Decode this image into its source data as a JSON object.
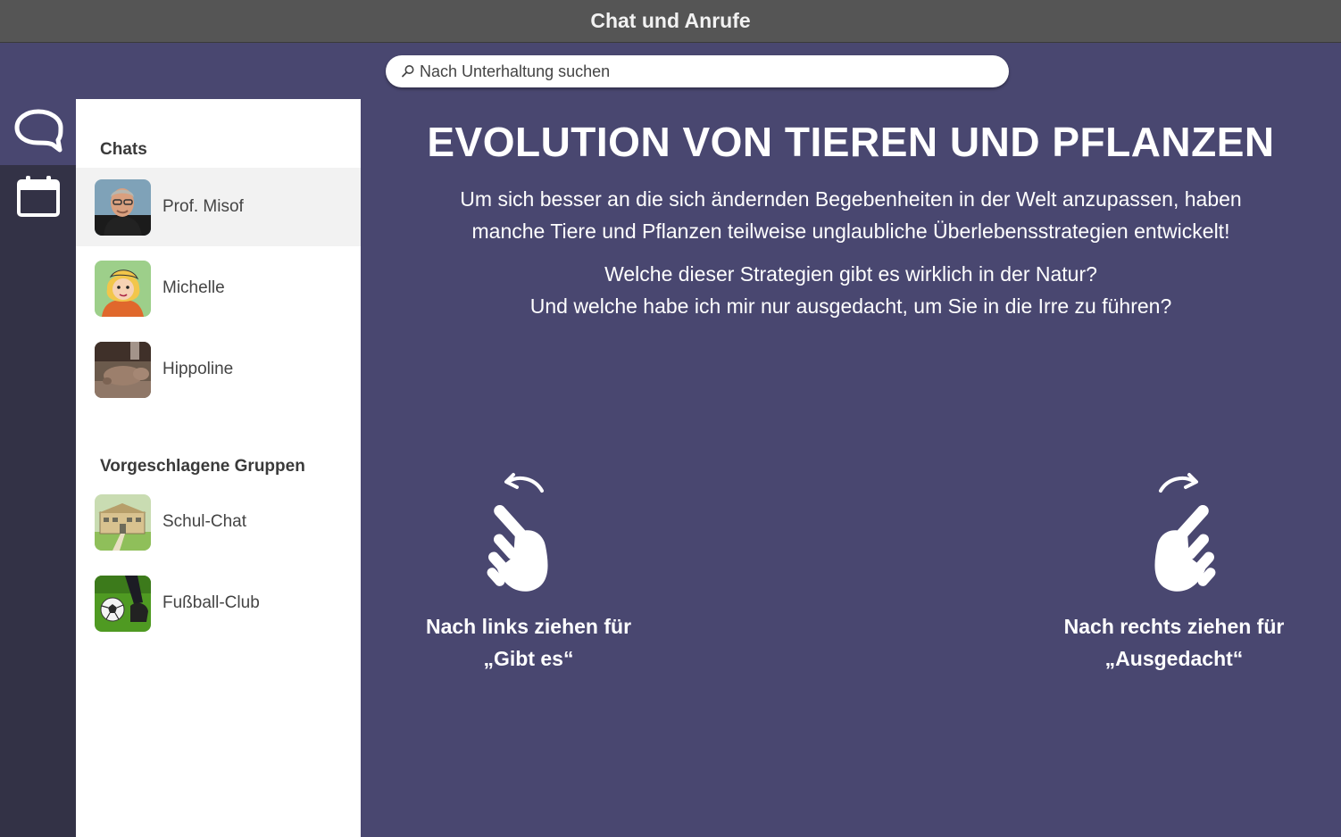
{
  "window": {
    "title": "Chat und Anrufe"
  },
  "search": {
    "placeholder": "Nach Unterhaltung suchen",
    "icon": "search-icon"
  },
  "rail": {
    "items": [
      {
        "icon": "chat-bubble-icon",
        "active": true
      },
      {
        "icon": "calendar-icon",
        "active": false
      }
    ]
  },
  "sidebar": {
    "chats_title": "Chats",
    "chats": [
      {
        "name": "Prof. Misof",
        "selected": true
      },
      {
        "name": "Michelle",
        "selected": false
      },
      {
        "name": "Hippoline",
        "selected": false
      }
    ],
    "groups_title": "Vorgeschlagene Gruppen",
    "groups": [
      {
        "name": "Schul-Chat"
      },
      {
        "name": "Fußball-Club"
      }
    ]
  },
  "main": {
    "title": "EVOLUTION VON TIEREN UND PFLANZEN",
    "intro_line1": "Um sich besser an die sich ändernden Begebenheiten in der Welt anzupassen, haben",
    "intro_line2": "manche Tiere und Pflanzen teilweise unglaubliche Überlebensstrategien entwickelt!",
    "question_line1": "Welche dieser Strategien gibt es wirklich in der Natur?",
    "question_line2": "Und welche habe ich mir nur ausgedacht, um Sie in die Irre zu führen?",
    "swipe_left": {
      "line1": "Nach links ziehen für",
      "line2": "„Gibt es“",
      "icon": "swipe-left-hand-icon"
    },
    "swipe_right": {
      "line1": "Nach rechts ziehen für",
      "line2": "„Ausgedacht“",
      "icon": "swipe-right-hand-icon"
    }
  },
  "colors": {
    "background": "#494770",
    "titlebar": "#555555",
    "rail": "#333246",
    "sidebar": "#ffffff",
    "selected_row": "#f2f2f2"
  }
}
